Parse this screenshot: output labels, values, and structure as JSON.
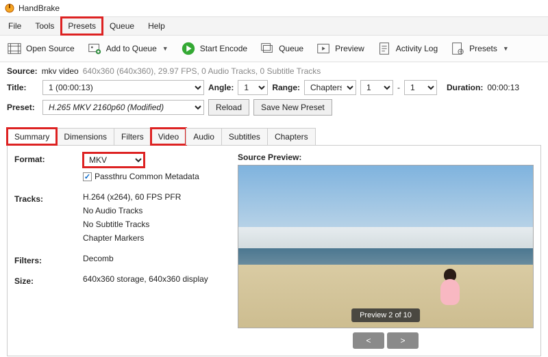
{
  "app": {
    "title": "HandBrake"
  },
  "menu": [
    "File",
    "Tools",
    "Presets",
    "Queue",
    "Help"
  ],
  "toolbar": {
    "open_source": "Open Source",
    "add_to_queue": "Add to Queue",
    "start_encode": "Start Encode",
    "queue": "Queue",
    "preview": "Preview",
    "activity_log": "Activity Log",
    "presets": "Presets"
  },
  "source": {
    "label": "Source:",
    "name": "mkv video",
    "info": "640x360 (640x360), 29.97 FPS, 0 Audio Tracks, 0 Subtitle Tracks"
  },
  "title": {
    "label": "Title:",
    "value": "1  (00:00:13)"
  },
  "angle": {
    "label": "Angle:",
    "value": "1"
  },
  "range": {
    "label": "Range:",
    "type": "Chapters",
    "from": "1",
    "dash": "-",
    "to": "1"
  },
  "duration": {
    "label": "Duration:",
    "value": "00:00:13"
  },
  "preset": {
    "label": "Preset:",
    "value": "H.265 MKV 2160p60  (Modified)",
    "reload": "Reload",
    "save_new": "Save New Preset"
  },
  "tabs": [
    "Summary",
    "Dimensions",
    "Filters",
    "Video",
    "Audio",
    "Subtitles",
    "Chapters"
  ],
  "summary": {
    "format": {
      "label": "Format:",
      "value": "MKV",
      "passthru": "Passthru Common Metadata"
    },
    "tracks": {
      "label": "Tracks:",
      "lines": [
        "H.264 (x264), 60 FPS PFR",
        "No Audio Tracks",
        "No Subtitle Tracks",
        "Chapter Markers"
      ]
    },
    "filters": {
      "label": "Filters:",
      "value": "Decomb"
    },
    "size": {
      "label": "Size:",
      "value": "640x360 storage, 640x360 display"
    }
  },
  "preview": {
    "label": "Source Preview:",
    "badge": "Preview 2 of 10",
    "prev": "<",
    "next": ">"
  }
}
